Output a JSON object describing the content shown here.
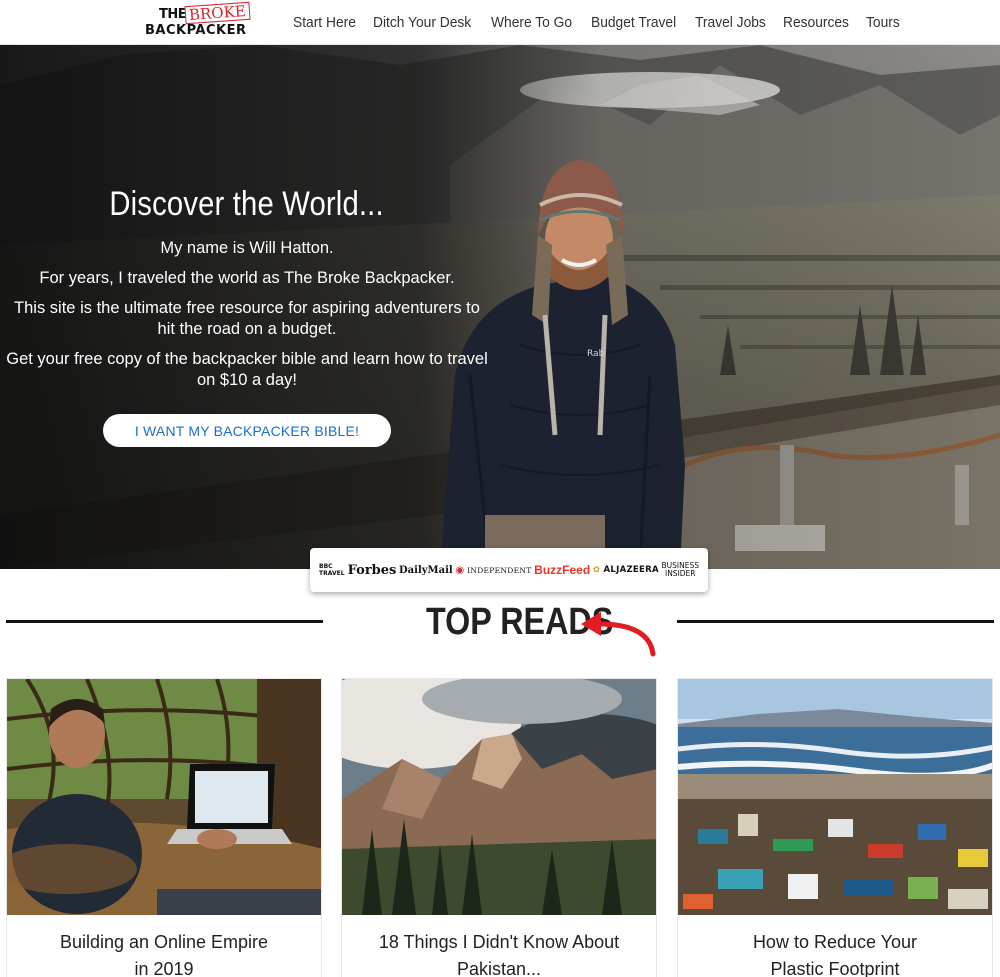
{
  "header": {
    "logo_line1": "THE",
    "logo_stamp": "BROKE",
    "logo_line2": "BACKPACKER",
    "nav": [
      "Start Here",
      "Ditch Your Desk",
      "Where To Go",
      "Budget Travel",
      "Travel Jobs",
      "Resources",
      "Tours"
    ]
  },
  "hero": {
    "title": "Discover the World...",
    "paragraphs": [
      "My name is Will Hatton.",
      "For years, I traveled the world as The Broke Backpacker.",
      "This site is the ultimate free resource for aspiring adventurers to hit the road on a budget.",
      "Get your free copy of the backpacker bible and learn how to travel on $10 a day!"
    ],
    "cta_label": "I WANT MY BACKPACKER BIBLE!",
    "jacket_logo": "Rab"
  },
  "press": {
    "bbc": "BBC TRAVEL",
    "forbes": "Forbes",
    "dailymail": "DailyMail",
    "independent": "INDEPENDENT",
    "buzzfeed": "BuzzFeed",
    "aljazeera": "ALJAZEERA",
    "business_insider_1": "BUSINESS",
    "business_insider_2": "INSIDER"
  },
  "top_reads": {
    "title": "TOP READS",
    "cards": [
      {
        "line1": "Building an Online Empire",
        "line2": "in 2019"
      },
      {
        "line1": "18 Things I Didn't Know About",
        "line2": "Pakistan..."
      },
      {
        "line1": "How to Reduce Your",
        "line2": "Plastic Footprint"
      }
    ]
  },
  "colors": {
    "cta_text": "#1a6fd1",
    "accent_red": "#d9232e",
    "buzzfeed": "#ee3322"
  }
}
